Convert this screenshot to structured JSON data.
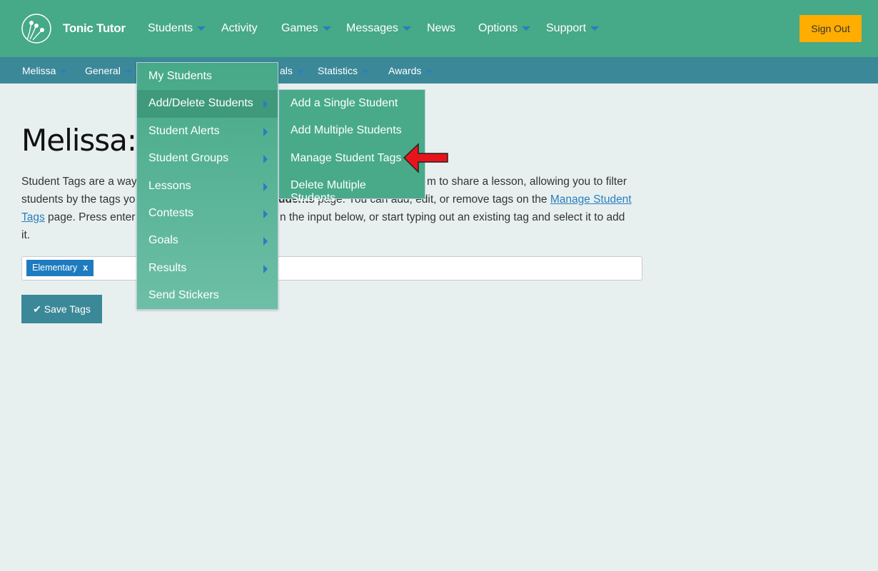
{
  "app": {
    "brand": "Tonic Tutor",
    "sign_out": "Sign Out"
  },
  "nav": [
    {
      "label": "Students",
      "dropdown": true
    },
    {
      "label": "Activity",
      "dropdown": false
    },
    {
      "label": "Games",
      "dropdown": true
    },
    {
      "label": "Messages",
      "dropdown": true
    },
    {
      "label": "News",
      "dropdown": false
    },
    {
      "label": "Options",
      "dropdown": true
    },
    {
      "label": "Support",
      "dropdown": true
    }
  ],
  "subnav": [
    {
      "label": "Melissa"
    },
    {
      "label": "General"
    },
    {
      "label": "als"
    },
    {
      "label": "Statistics"
    },
    {
      "label": "Awards"
    }
  ],
  "page": {
    "title": "Melissa:",
    "text_fragments": [
      "Student Tags are a way",
      "m to share a lesson, allowing you to filter",
      "students by the tags yo",
      "udents",
      " page. You can add, edit, or remove tags on the ",
      "Manage Student",
      "Tags",
      " page. Press enter",
      "n the input below, or start typing out an existing tag and select it to add",
      "it."
    ],
    "tags": [
      {
        "label": "Elementary",
        "remove": "x"
      }
    ],
    "save_label": "Save Tags"
  },
  "menu": {
    "items": [
      {
        "label": "My Students"
      },
      {
        "label": "Add/Delete Students"
      },
      {
        "label": "Student Alerts"
      },
      {
        "label": "Student Groups"
      },
      {
        "label": "Lessons"
      },
      {
        "label": "Contests"
      },
      {
        "label": "Goals"
      },
      {
        "label": "Results"
      },
      {
        "label": "Send Stickers"
      }
    ],
    "submenu": [
      {
        "label": "Add a Single Student"
      },
      {
        "label": "Add Multiple Students"
      },
      {
        "label": "Manage Student Tags"
      },
      {
        "label": "Delete Multiple Students"
      }
    ]
  },
  "colors": {
    "header": "#46a987",
    "subnav": "#3b8898",
    "signout": "#ffad00",
    "tag": "#1e7bc0",
    "annotation_arrow": "#e8141c"
  }
}
